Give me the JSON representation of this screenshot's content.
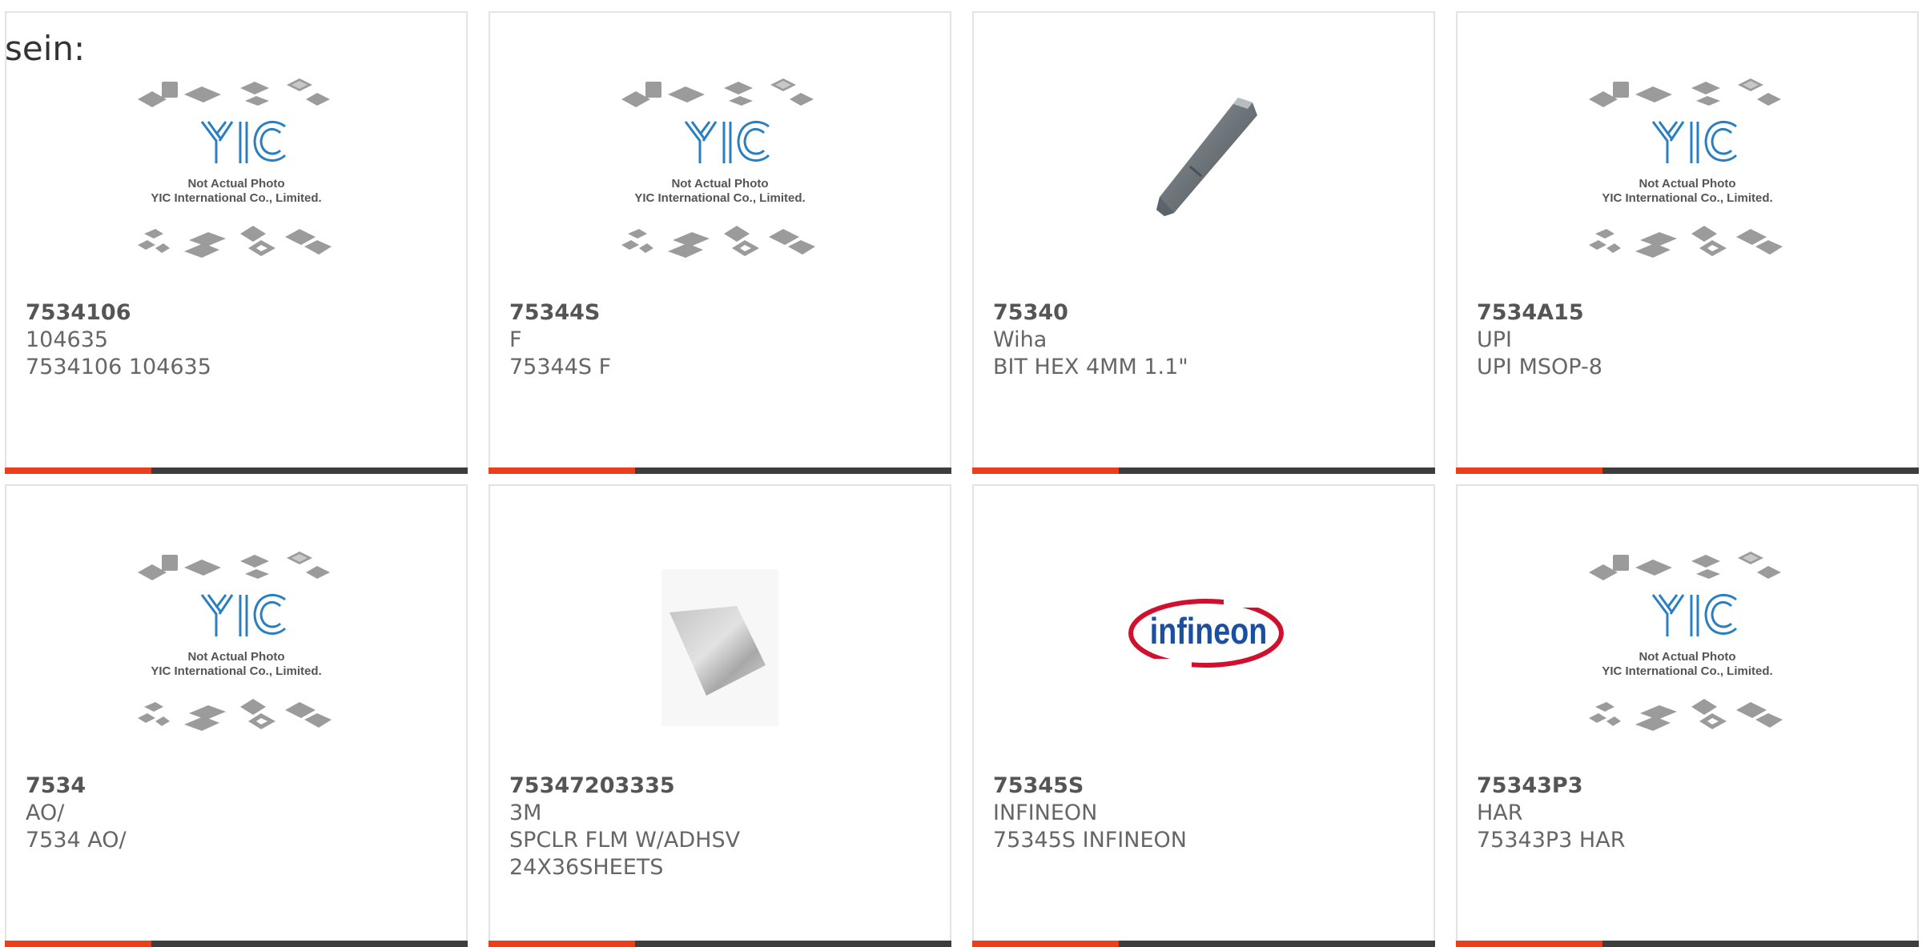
{
  "intro": "sein:",
  "placeholder_text": {
    "line1": "Not Actual Photo",
    "line2": "YIC International Co., Limited.",
    "logo": "YIC"
  },
  "infineon_logo": "infineon",
  "colors": {
    "accent": "#e8401c",
    "bar_dark": "#3d3d3d",
    "border": "#e3e3e3",
    "text": "#666666",
    "yic_blue": "#2a7fc0",
    "infineon_red": "#d0102c",
    "infineon_blue": "#1b4fa0"
  },
  "products": [
    {
      "part": "7534106",
      "maker": "104635",
      "desc": "7534106 104635",
      "image": "yic-placeholder"
    },
    {
      "part": "75344S",
      "maker": "F",
      "desc": "75344S F",
      "image": "yic-placeholder"
    },
    {
      "part": "75340",
      "maker": "Wiha",
      "desc": "BIT HEX 4MM 1.1\"",
      "image": "hex-bit"
    },
    {
      "part": "7534A15",
      "maker": "UPI",
      "desc": "UPI MSOP-8",
      "image": "yic-placeholder"
    },
    {
      "part": "7534",
      "maker": "AO/",
      "desc": "7534 AO/",
      "image": "yic-placeholder"
    },
    {
      "part": "75347203335",
      "maker": "3M",
      "desc": "SPCLR FLM W/ADHSV",
      "desc2": "24X36SHEETS",
      "image": "film-sheet"
    },
    {
      "part": "75345S",
      "maker": "INFINEON",
      "desc": "75345S INFINEON",
      "image": "infineon-logo"
    },
    {
      "part": "75343P3",
      "maker": "HAR",
      "desc": "75343P3 HAR",
      "image": "yic-placeholder"
    }
  ]
}
